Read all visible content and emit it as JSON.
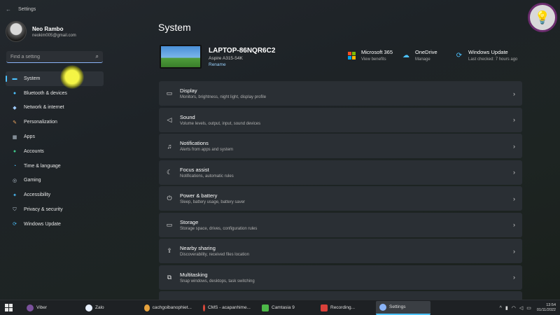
{
  "window": {
    "title": "Settings"
  },
  "profile": {
    "name": "Neo Rambo",
    "email": "neokim005@gmail.com"
  },
  "search": {
    "placeholder": "Find a setting"
  },
  "nav": {
    "items": [
      {
        "label": "System",
        "icon": "monitor-icon",
        "color": "#4cc2ff",
        "glyph": "▬"
      },
      {
        "label": "Bluetooth & devices",
        "icon": "bluetooth-icon",
        "color": "#4cc2ff",
        "glyph": "●"
      },
      {
        "label": "Network & internet",
        "icon": "wifi-icon",
        "color": "#9ecbff",
        "glyph": "◆"
      },
      {
        "label": "Personalization",
        "icon": "brush-icon",
        "color": "#f0a860",
        "glyph": "✎"
      },
      {
        "label": "Apps",
        "icon": "apps-icon",
        "color": "#b8c4d0",
        "glyph": "▦"
      },
      {
        "label": "Accounts",
        "icon": "person-icon",
        "color": "#3ec78a",
        "glyph": "●"
      },
      {
        "label": "Time & language",
        "icon": "globe-clock-icon",
        "color": "#4cc2ff",
        "glyph": "◔"
      },
      {
        "label": "Gaming",
        "icon": "gamepad-icon",
        "color": "#b8c4d0",
        "glyph": "◎"
      },
      {
        "label": "Accessibility",
        "icon": "accessibility-icon",
        "color": "#4cc2ff",
        "glyph": "✦"
      },
      {
        "label": "Privacy & security",
        "icon": "shield-icon",
        "color": "#b8c4d0",
        "glyph": "⛉"
      },
      {
        "label": "Windows Update",
        "icon": "update-icon",
        "color": "#4cc2ff",
        "glyph": "⟳"
      }
    ]
  },
  "main": {
    "title": "System",
    "device": {
      "name": "LAPTOP-86NQR6C2",
      "model": "Aspire A315-54K",
      "rename": "Rename"
    },
    "quick": [
      {
        "title": "Microsoft 365",
        "sub": "View benefits",
        "icon": "microsoft-icon"
      },
      {
        "title": "OneDrive",
        "sub": "Manage",
        "icon": "onedrive-icon"
      },
      {
        "title": "Windows Update",
        "sub": "Last checked: 7 hours ago",
        "icon": "update-icon"
      }
    ],
    "rows": [
      {
        "title": "Display",
        "sub": "Monitors, brightness, night light, display profile",
        "icon": "display-icon",
        "glyph": "▭"
      },
      {
        "title": "Sound",
        "sub": "Volume levels, output, input, sound devices",
        "icon": "speaker-icon",
        "glyph": "🔊"
      },
      {
        "title": "Notifications",
        "sub": "Alerts from apps and system",
        "icon": "bell-icon",
        "glyph": "🔔"
      },
      {
        "title": "Focus assist",
        "sub": "Notifications, automatic rules",
        "icon": "moon-icon",
        "glyph": "☾"
      },
      {
        "title": "Power & battery",
        "sub": "Sleep, battery usage, battery saver",
        "icon": "power-icon",
        "glyph": "⏻"
      },
      {
        "title": "Storage",
        "sub": "Storage space, drives, configuration rules",
        "icon": "drive-icon",
        "glyph": "▭"
      },
      {
        "title": "Nearby sharing",
        "sub": "Discoverability, received files location",
        "icon": "share-icon",
        "glyph": "⇪"
      },
      {
        "title": "Multitasking",
        "sub": "Snap windows, desktops, task switching",
        "icon": "multitask-icon",
        "glyph": "⧉"
      }
    ]
  },
  "taskbar": {
    "items": [
      {
        "label": "Viber",
        "color": "#7b519d"
      },
      {
        "label": "Zalo",
        "color": "#e8f1ff"
      },
      {
        "label": "cachgoibanophiet...",
        "color": "#e7a23d"
      },
      {
        "label": "CMS - acapanhime...",
        "color": "#e04a3b"
      },
      {
        "label": "Camtasia 9",
        "color": "#4db848"
      },
      {
        "label": "Recording...",
        "color": "#d9403a"
      },
      {
        "label": "Settings",
        "color": "#8ab4f8"
      }
    ],
    "time": "13:54",
    "date": "01/11/2022"
  },
  "colors": {
    "accent": "#4cc2ff",
    "cursor_highlight": "#ffff46"
  }
}
